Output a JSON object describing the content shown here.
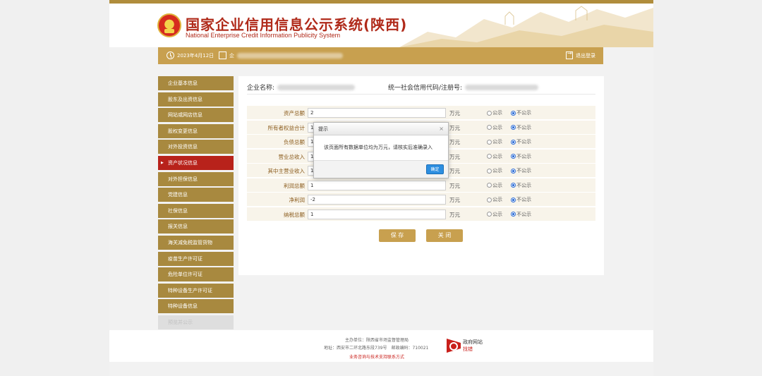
{
  "header": {
    "title_cn": "国家企业信用信息公示系统(陕西)",
    "title_en": "National Enterprise Credit Information Publicity System"
  },
  "topbar": {
    "date": "2023年4月12日",
    "company_prefix": "企",
    "logout": "退出登录"
  },
  "sidebar": {
    "items": [
      {
        "label": "企业基本信息"
      },
      {
        "label": "股东及出资信息"
      },
      {
        "label": "网站或网店信息"
      },
      {
        "label": "股权变更信息"
      },
      {
        "label": "对外投资信息"
      },
      {
        "label": "资产状况信息"
      },
      {
        "label": "对外担保信息"
      },
      {
        "label": "党建信息"
      },
      {
        "label": "社保信息"
      },
      {
        "label": "报关信息"
      },
      {
        "label": "海关减免税监管货物"
      },
      {
        "label": "疫苗生产许可证"
      },
      {
        "label": "危险单位许可证"
      },
      {
        "label": "特种设备生产许可证"
      },
      {
        "label": "特种设备信息"
      },
      {
        "label": "预览并公示"
      }
    ]
  },
  "main": {
    "company_label": "企业名称:",
    "credit_label": "统一社会信用代码/注册号:",
    "unit": "万元",
    "public_label": "公示",
    "private_label": "不公示",
    "rows": [
      {
        "label": "资产总额",
        "value": "2"
      },
      {
        "label": "所有者权益合计",
        "value": "1"
      },
      {
        "label": "负债总额",
        "value": "1"
      },
      {
        "label": "营业总收入",
        "value": "1"
      },
      {
        "label": "其中主营业收入",
        "value": "1"
      },
      {
        "label": "利润总额",
        "value": "1"
      },
      {
        "label": "净利润",
        "value": "-2"
      },
      {
        "label": "纳税总额",
        "value": "1"
      }
    ],
    "save_button": "保 存",
    "close_button": "关 闭"
  },
  "dialog": {
    "title": "提示",
    "close": "×",
    "message": "该页面所有数据单位均为万元，请核实后准确录入",
    "ok": "确定"
  },
  "footer": {
    "sponsor": "主办单位：陕西省市场监督管理局",
    "address": "地址：西安市二环北路东段739号　邮政编码：710021",
    "contact": "业务咨询与技术支持联系方式",
    "gov_badge_1": "政府网站",
    "gov_badge_2": "找错"
  },
  "colors": {
    "gold": "#c8a04f",
    "nav": "#a8893f",
    "active": "#b8221b",
    "brand_red": "#b02a1a"
  }
}
